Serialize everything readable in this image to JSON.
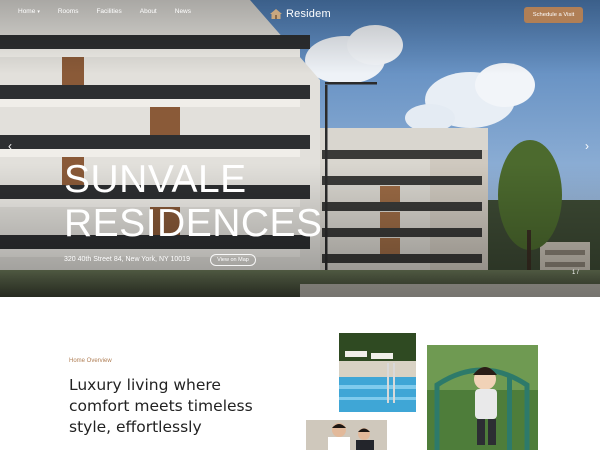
{
  "nav": {
    "items": [
      {
        "label": "Home",
        "has_dropdown": true
      },
      {
        "label": "Rooms"
      },
      {
        "label": "Facilities"
      },
      {
        "label": "About"
      },
      {
        "label": "News"
      }
    ]
  },
  "brand": {
    "name": "Residem",
    "icon": "house-logo-icon"
  },
  "header": {
    "cta_label": "Schedule a Visit"
  },
  "hero": {
    "title_line1": "SUNVALE",
    "title_line2": "RESIDENCES",
    "address": "320 40th Street 84, New York, NY 10019",
    "map_button": "View on Map",
    "prev_icon": "chevron-left-icon",
    "next_icon": "chevron-right-icon",
    "pager": "1 /"
  },
  "overview": {
    "eyebrow": "Home Overview",
    "headline_lines": [
      "Luxury living where",
      "comfort meets timeless",
      "style, effortlessly"
    ]
  },
  "colors": {
    "accent": "#b07f56",
    "text": "#222222",
    "background": "#ffffff"
  }
}
